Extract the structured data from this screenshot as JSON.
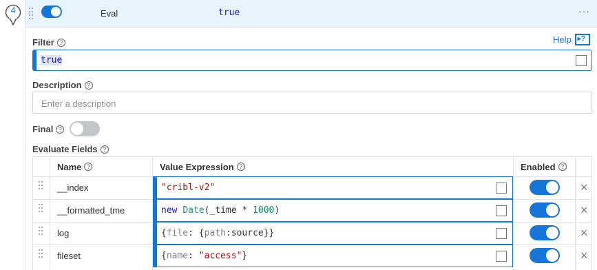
{
  "step": {
    "number": "4"
  },
  "header": {
    "function_name": "Eval",
    "filter_preview": "true",
    "more_label": "···"
  },
  "help": {
    "label": "Help"
  },
  "filter": {
    "label": "Filter",
    "value": "true"
  },
  "description": {
    "label": "Description",
    "placeholder": "Enter a description"
  },
  "final": {
    "label": "Final",
    "enabled": false
  },
  "evaluate_fields": {
    "label": "Evaluate Fields",
    "columns": {
      "name": "Name",
      "value": "Value Expression",
      "enabled": "Enabled"
    },
    "rows": [
      {
        "name": "__index",
        "value": "\"cribl-v2\"",
        "enabled": true
      },
      {
        "name": "__formatted_tme",
        "value": "new Date(_time * 1000)",
        "enabled": true
      },
      {
        "name": "log",
        "value": "{file: {path:source}}",
        "enabled": true
      },
      {
        "name": "fileset",
        "value": "{name: \"access\"}",
        "enabled": true
      }
    ]
  },
  "colors": {
    "accent": "#1675d8",
    "header_bg": "#e9f5fc",
    "string": "#a31515",
    "keyword": "#1a1ab8"
  }
}
